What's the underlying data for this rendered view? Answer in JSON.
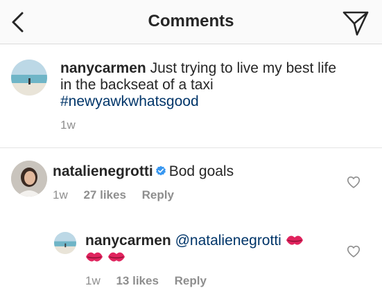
{
  "header": {
    "title": "Comments"
  },
  "caption": {
    "username": "nanycarmen",
    "text": "Just trying to live my best life in the backseat of a taxi",
    "hashtag": "#newyawkwhatsgood",
    "time": "1w"
  },
  "comments": [
    {
      "username": "natalienegrotti",
      "verified": true,
      "text": "Bod goals",
      "time": "1w",
      "likes": "27 likes",
      "reply_label": "Reply"
    },
    {
      "username": "nanycarmen",
      "mention": "@natalienegrotti",
      "emoji": "kiss-mark",
      "time": "1w",
      "likes": "13 likes",
      "reply_label": "Reply"
    }
  ],
  "colors": {
    "link": "#003569",
    "muted": "#8e8e8e",
    "verified": "#3897f0",
    "kiss": "#e0245e"
  }
}
